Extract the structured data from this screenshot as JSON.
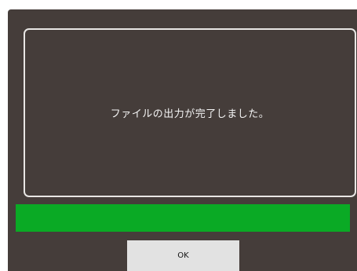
{
  "dialog": {
    "message": "ファイルの出力が完了しました。",
    "progress": 1.0,
    "ok_label": "OK"
  },
  "colors": {
    "dialog_background": "#453d3a",
    "panel_border": "#e8e6e4",
    "progress_fill": "#0aaa25",
    "button_background": "#e2e2e2"
  }
}
